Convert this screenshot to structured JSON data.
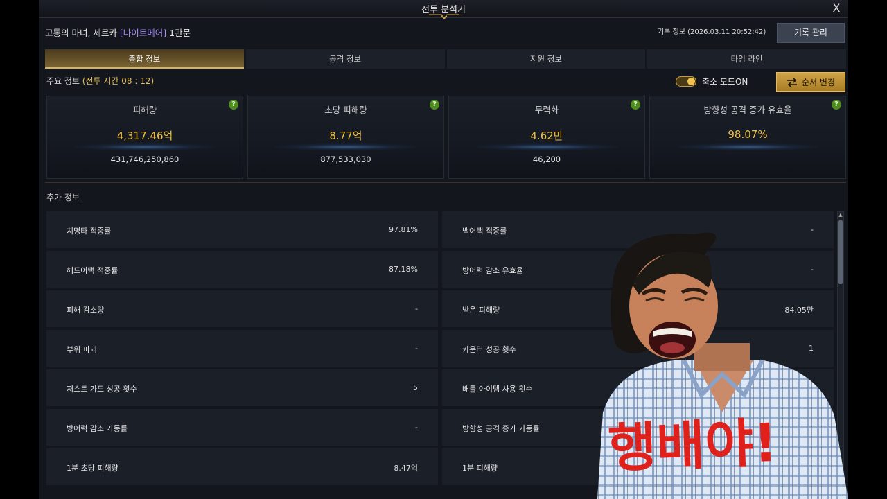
{
  "window": {
    "title": "전투 분석기",
    "close_label": "X"
  },
  "header": {
    "boss_prefix": "고통의 마녀, 세르카 ",
    "boss_difficulty": "[나이트메어]",
    "boss_suffix": " 1관문",
    "record_info": "기록 정보 (2026.03.11 20:52:42)",
    "record_button": "기록 관리"
  },
  "tabs": [
    {
      "label": "종합 정보",
      "active": true
    },
    {
      "label": "공격 정보",
      "active": false
    },
    {
      "label": "지원 정보",
      "active": false
    },
    {
      "label": "타임 라인",
      "active": false
    }
  ],
  "main": {
    "label": "주요 정보 ",
    "battle_time": "(전투 시간 08 : 12)",
    "compact_mode": "축소 모드ON",
    "order_button": "순서 변경"
  },
  "cards": [
    {
      "title": "피해량",
      "value": "4,317.46억",
      "raw": "431,746,250,860"
    },
    {
      "title": "초당 피해량",
      "value": "8.77억",
      "raw": "877,533,030"
    },
    {
      "title": "무력화",
      "value": "4.62만",
      "raw": "46,200"
    },
    {
      "title": "방향성 공격 증가 유효율",
      "value": "98.07%",
      "raw": ""
    }
  ],
  "help_icon_text": "?",
  "extra": {
    "label": "추가 정보",
    "rows": [
      [
        {
          "label": "치명타 적중률",
          "value": "97.81%"
        },
        {
          "label": "백어택 적중률",
          "value": "-"
        }
      ],
      [
        {
          "label": "헤드어택 적중률",
          "value": "87.18%"
        },
        {
          "label": "방어력 감소 유효율",
          "value": "-"
        }
      ],
      [
        {
          "label": "피해 감소량",
          "value": "-"
        },
        {
          "label": "받은 피해량",
          "value": "84.05만"
        }
      ],
      [
        {
          "label": "부위 파괴",
          "value": "-"
        },
        {
          "label": "카운터 성공 횟수",
          "value": "1"
        }
      ],
      [
        {
          "label": "저스트 가드 성공 횟수",
          "value": "5"
        },
        {
          "label": "배틀 아이템 사용 횟수",
          "value": ""
        }
      ],
      [
        {
          "label": "방어력 감소 가동률",
          "value": "-"
        },
        {
          "label": "방향성 공격 증가 가동률",
          "value": ""
        }
      ],
      [
        {
          "label": "1분 초당 피해량",
          "value": "8.47억"
        },
        {
          "label": "1분 피해량",
          "value": ""
        }
      ]
    ]
  },
  "overlay": {
    "caption": "행배야!"
  },
  "colors": {
    "accent_gold": "#e3bd5d",
    "value_gold": "#f0bf3c",
    "difficulty_purple": "#a48bf0",
    "help_green": "#4e8c1e",
    "caption_red": "#e0201a"
  }
}
